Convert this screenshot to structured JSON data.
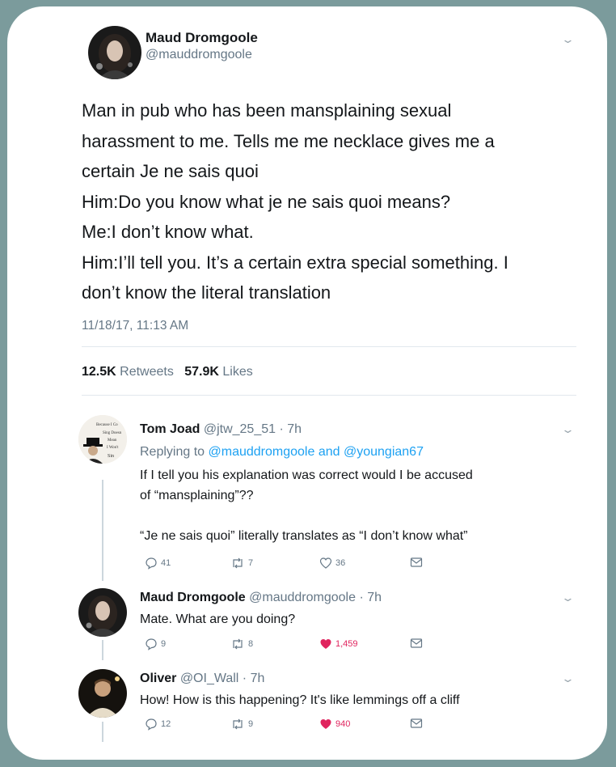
{
  "tweet": {
    "author_name": "Maud Dromgoole",
    "author_handle": "@mauddromgoole",
    "lines": [
      "Man in pub who has been mansplaining sexual",
      "harassment to me. Tells me me necklace gives me a",
      "certain Je ne sais quoi",
      "Him:Do you know what je ne sais quoi means?",
      "Me:I don’t know what.",
      "Him:I’ll tell you. It’s a certain extra special something. I",
      "don’t know the literal translation"
    ],
    "timestamp": "11/18/17, 11:13 AM",
    "retweets_count": "12.5K",
    "retweets_label": "Retweets",
    "likes_count": "57.9K",
    "likes_label": "Likes",
    "menu_icon": "chevron-down-icon"
  },
  "avatar_texts": [
    "Because I Co",
    "Sing Doesn",
    "Mean",
    "I Won't",
    "Sin"
  ],
  "replies": [
    {
      "name": "Tom Joad",
      "meta": "@jtw_25_51 · 7h",
      "replying_prefix": "Replying to",
      "replying_to_1": "@mauddromgoole",
      "replying_and": "and",
      "replying_to_2": "@youngian67",
      "lines": [
        "If I tell you his explanation was correct would I be accused",
        "of “mansplaining”??",
        "",
        "“Je ne sais quoi” literally translates as “I don’t know what”"
      ],
      "replies": "41",
      "retweets": "7",
      "likes": "36",
      "liked": false
    },
    {
      "name": "Maud Dromgoole",
      "meta": "@mauddromgoole · 7h",
      "lines": [
        "Mate. What are you doing?"
      ],
      "replies": "9",
      "retweets": "8",
      "likes": "1,459",
      "liked": true
    },
    {
      "name": "Oliver",
      "meta": "@OI_Wall · 7h",
      "lines": [
        "How! How is this happening? It's like lemmings off a cliff"
      ],
      "replies": "12",
      "retweets": "9",
      "likes": "940",
      "liked": true
    }
  ],
  "colors": {
    "background": "#7b9b9c",
    "link": "#1da1f2",
    "like_active": "#e0245e",
    "muted": "#657786"
  }
}
